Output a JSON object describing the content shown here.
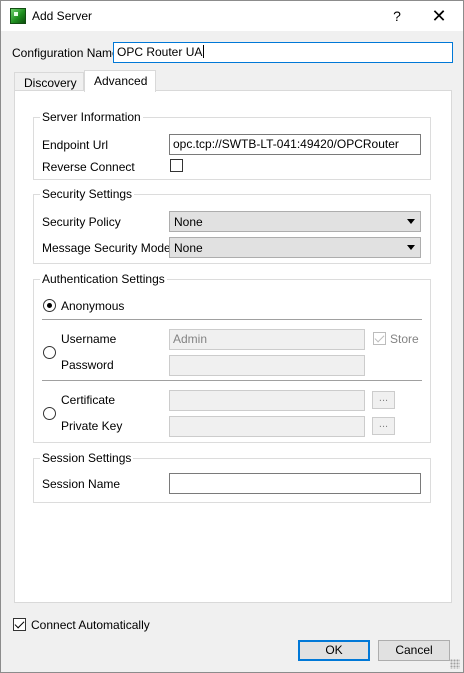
{
  "window": {
    "title": "Add Server",
    "help_glyph": "?",
    "close_glyph": "✕"
  },
  "config": {
    "label": "Configuration Name",
    "value": "OPC Router UA"
  },
  "tabs": [
    {
      "label": "Discovery",
      "active": false
    },
    {
      "label": "Advanced",
      "active": true
    }
  ],
  "server_info": {
    "title": "Server Information",
    "endpoint_label": "Endpoint Url",
    "endpoint_value": "opc.tcp://SWTB-LT-041:49420/OPCRouter",
    "reverse_label": "Reverse Connect",
    "reverse_checked": false
  },
  "security": {
    "title": "Security Settings",
    "policy_label": "Security Policy",
    "policy_value": "None",
    "mode_label": "Message Security Mode",
    "mode_value": "None"
  },
  "auth": {
    "title": "Authentication Settings",
    "anonymous_label": "Anonymous",
    "anonymous_selected": true,
    "username_label": "Username",
    "username_value": "Admin",
    "store_label": "Store",
    "store_checked": true,
    "password_label": "Password",
    "password_value": "",
    "certificate_label": "Certificate",
    "certificate_value": "",
    "private_key_label": "Private Key",
    "private_key_value": "",
    "browse_label": "..."
  },
  "session": {
    "title": "Session Settings",
    "name_label": "Session Name",
    "name_value": ""
  },
  "footer": {
    "connect_auto_label": "Connect Automatically",
    "connect_auto_checked": true,
    "ok_label": "OK",
    "cancel_label": "Cancel"
  }
}
